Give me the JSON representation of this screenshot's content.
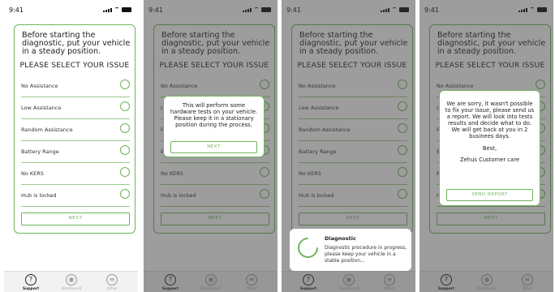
{
  "status_bar": {
    "time": "9:41"
  },
  "card": {
    "intro": "Before starting the diagnostic, put your vehicle in a steady position.",
    "heading": "PLEASE SELECT YOUR ISSUE",
    "issues": [
      "No Assistance",
      "Low Assistance",
      "Random Assistance",
      "Battery Range",
      "No KERS",
      "Hub is locked"
    ],
    "next_label": "NEXT"
  },
  "tabs": [
    {
      "label": "Support",
      "icon": "question-icon"
    },
    {
      "label": "Dashboard",
      "icon": "gauge-icon"
    },
    {
      "label": "Other",
      "icon": "menu-icon"
    }
  ],
  "screen2_modal": {
    "message": "This will perform some hardware tests on your vehicle. Please keep it in a stationary position during the process.",
    "button": "NEXT"
  },
  "screen3_toast": {
    "title": "Diagnostic",
    "message": "Diagnostic procedure in progress, please keep your vehicle in a stable position..."
  },
  "screen4_modal": {
    "message": "We are sorry, it wasn't possible to fix your issue, please send us a report. We will look into tests results and decide what to do. We will get back at you in 2 businees days.",
    "closing": "Best,",
    "signature": "Zehus Customer care",
    "button": "SEND REPORT"
  },
  "colors": {
    "accent": "#6fb45a"
  }
}
